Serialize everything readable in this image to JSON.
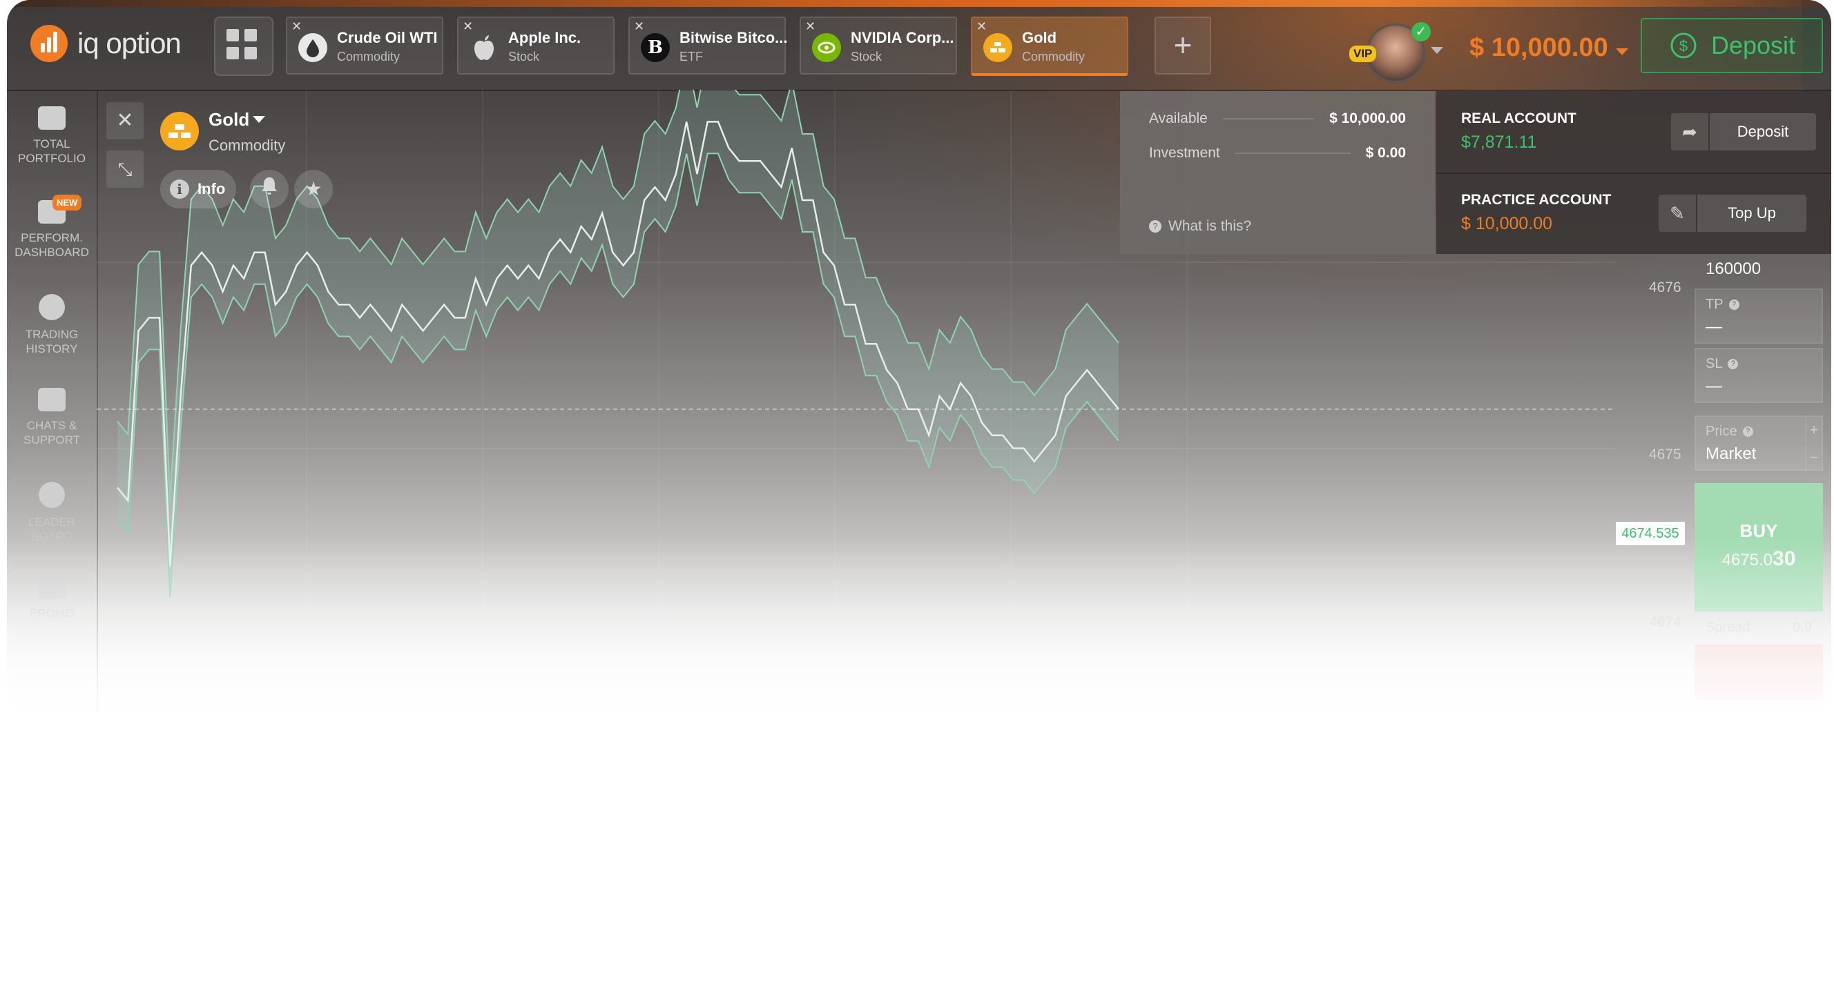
{
  "brand": {
    "name": "iq option",
    "color": "#f07c23"
  },
  "header": {
    "tabs": [
      {
        "name": "Crude Oil WTI",
        "type": "Commodity",
        "icon": "oil-drop-icon",
        "active": false
      },
      {
        "name": "Apple Inc.",
        "type": "Stock",
        "icon": "apple-icon",
        "active": false
      },
      {
        "name": "Bitwise Bitco...",
        "type": "ETF",
        "icon": "bitwise-b-icon",
        "icon_text": "B",
        "active": false
      },
      {
        "name": "NVIDIA Corp...",
        "type": "Stock",
        "icon": "nvidia-icon",
        "active": false
      },
      {
        "name": "Gold",
        "type": "Commodity",
        "icon": "gold-bars-icon",
        "active": true
      }
    ],
    "add_tab_label": "+",
    "vip_label": "VIP",
    "balance": "$ 10,000.00",
    "deposit_label": "Deposit"
  },
  "sidebar": {
    "items": [
      {
        "label_lines": [
          "TOTAL",
          "PORTFOLIO"
        ],
        "icon": "briefcase-icon"
      },
      {
        "label_lines": [
          "PERFORM.",
          "DASHBOARD"
        ],
        "icon": "dashboard-icon",
        "badge": "NEW"
      },
      {
        "label_lines": [
          "TRADING",
          "HISTORY"
        ],
        "icon": "clock-icon"
      },
      {
        "label_lines": [
          "CHATS &",
          "SUPPORT"
        ],
        "icon": "chat-icon"
      },
      {
        "label_lines": [
          "LEADER",
          "BOARD"
        ],
        "icon": "medal-icon"
      },
      {
        "label_lines": [
          "PROMO",
          ""
        ],
        "icon": "megaphone-icon"
      }
    ]
  },
  "asset": {
    "name": "Gold",
    "type": "Commodity",
    "info_label": "Info",
    "info_icon": "info-icon",
    "bell_icon": "bell-icon",
    "star_icon": "star-icon"
  },
  "chart": {
    "y_ticks": [
      "4676",
      "4675",
      "4674"
    ],
    "current_price": "4674.535"
  },
  "account_popup": {
    "available_label": "Available",
    "available_value": "$ 10,000.00",
    "investment_label": "Investment",
    "investment_value": "$ 0.00",
    "what_label": "What is this?",
    "real_account_label": "REAL ACCOUNT",
    "real_account_value": "$7,871.11",
    "real_account_button": "Deposit",
    "practice_account_label": "PRACTICE ACCOUNT",
    "practice_account_value": "$ 10,000.00",
    "practice_account_button": "Top Up",
    "colors": {
      "real": "#3cc26a",
      "practice": "#f07c23"
    }
  },
  "trade_panel": {
    "amount": "160000",
    "tp_label": "TP",
    "tp_value": "—",
    "sl_label": "SL",
    "sl_value": "—",
    "price_label": "Price",
    "price_value": "Market",
    "buy_label": "BUY",
    "buy_price_main": "4675.0",
    "buy_price_big": "30",
    "spread_label": "Spread",
    "spread_value": "0.9"
  },
  "chart_data": {
    "type": "area",
    "title": "",
    "ylim": [
      4673.6,
      4676.4
    ],
    "series": [
      {
        "values": [
          4674.2,
          4674.1,
          4675.4,
          4675.5,
          4675.5,
          4673.6,
          4674.9,
          4675.9,
          4676.0,
          4675.9,
          4675.7,
          4675.9,
          4675.8,
          4676.0,
          4676.0,
          4675.6,
          4675.7,
          4675.9,
          4676.0,
          4675.9,
          4675.7,
          4675.6,
          4675.6,
          4675.5,
          4675.6,
          4675.5,
          4675.4,
          4675.6,
          4675.5,
          4675.4,
          4675.5,
          4675.6,
          4675.5,
          4675.5,
          4675.8,
          4675.6,
          4675.8,
          4675.9,
          4675.8,
          4675.9,
          4675.8,
          4676.0,
          4676.1,
          4676.0,
          4676.2,
          4676.1,
          4676.3,
          4676.0,
          4675.9,
          4676.0,
          4676.4,
          4676.5,
          4676.4,
          4676.6,
          4677.0,
          4676.6,
          4677.0,
          4677.0,
          4676.8,
          4676.7,
          4676.7,
          4676.7,
          4676.6,
          4676.5,
          4676.8,
          4676.4,
          4676.4,
          4676.0,
          4675.9,
          4675.6,
          4675.6,
          4675.3,
          4675.3,
          4675.1,
          4675.0,
          4674.8,
          4674.8,
          4674.6,
          4674.9,
          4674.8,
          4675.0,
          4674.9,
          4674.7,
          4674.6,
          4674.6,
          4674.5,
          4674.5,
          4674.4,
          4674.5,
          4674.6,
          4674.9,
          4675.0,
          4675.1,
          4675.0,
          4674.9,
          4674.8
        ]
      }
    ]
  }
}
